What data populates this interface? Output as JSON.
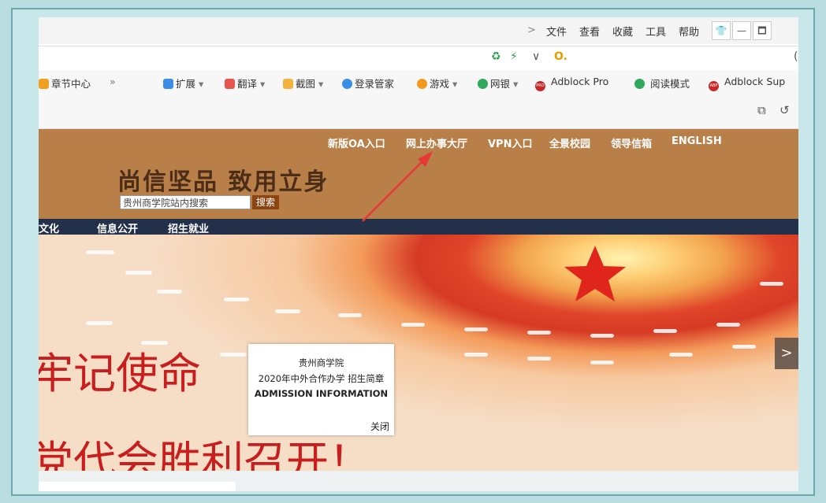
{
  "menubar": {
    "chevron": ">",
    "items": [
      "文件",
      "查看",
      "收藏",
      "工具",
      "帮助"
    ],
    "window_buttons": [
      "👕",
      "—",
      "🗖"
    ]
  },
  "address": {
    "icons": [
      "refresh-icon",
      "lightning-icon",
      "dropdown-icon",
      "search-engine-icon"
    ],
    "dropdown": "∨",
    "engine": "O.",
    "extra": "("
  },
  "toolbar": {
    "chapter": "章节中心",
    "more": "»",
    "extend": "扩展",
    "translate": "翻译",
    "screenshot": "截图",
    "login_manager": "登录管家",
    "games": "游戏",
    "bank": "网银",
    "adblock_pro": "Adblock Pro",
    "reading_mode": "阅读模式",
    "adblock_sup": "Adblock Sup",
    "dropdown": "▾",
    "pro_badge": "PRO",
    "abp_badge": "ABP"
  },
  "site": {
    "nav": [
      "新版OA入口",
      "网上办事大厅",
      "VPN入口",
      "全景校园",
      "领导信箱",
      "ENGLISH"
    ],
    "motto": "尚信坚品 致用立身",
    "search_placeholder": "贵州商学院站内搜索",
    "search_button": "搜索",
    "subnav": [
      "文化",
      "信息公开",
      "招生就业"
    ]
  },
  "banner": {
    "line1": "牢记使命",
    "line2": "党代会胜利召开！"
  },
  "popup": {
    "school": "贵州商学院",
    "title": "2020年中外合作办学 招生简章",
    "subtitle": "ADMISSION INFORMATION",
    "close": "关闭"
  },
  "next_button": ">",
  "accent_colors": {
    "header_bg": "#b97f48",
    "subnav_bg": "#223049",
    "search_btn": "#8b4513",
    "arrow": "#e53935"
  }
}
